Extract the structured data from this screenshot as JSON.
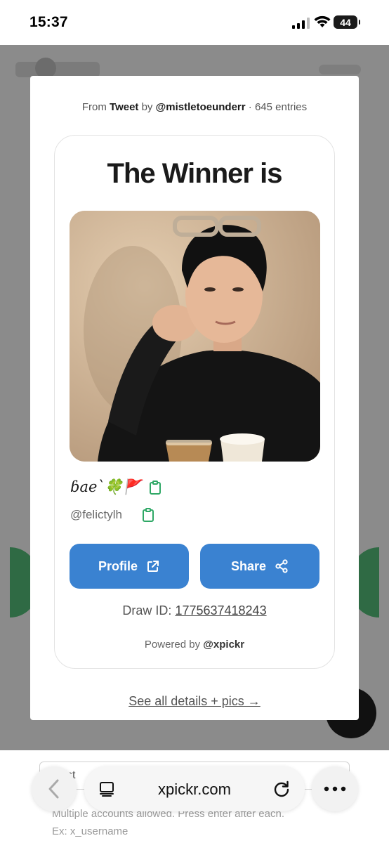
{
  "status_bar": {
    "time": "15:37",
    "battery": "44",
    "icons": [
      "signal-icon",
      "wifi-icon",
      "battery-icon"
    ]
  },
  "modal": {
    "source": {
      "prefix": "From",
      "platform": "Tweet",
      "by": "by",
      "author": "@mistletoeunderr",
      "separator": "·",
      "entries": "645 entries"
    },
    "title": "The Winner is",
    "winner": {
      "display_name": "ɓae`🍀🚩",
      "username": "@felictylh"
    },
    "buttons": {
      "profile_label": "Profile",
      "share_label": "Share"
    },
    "draw_id_label": "Draw ID:",
    "draw_id_value": "1775637418243",
    "powered_prefix": "Powered by",
    "powered_brand": "@xpickr",
    "see_all": "See all details + pics →"
  },
  "background_page": {
    "input_fragment": "st",
    "help_line1": "Multiple accounts allowed. Press enter after each.",
    "help_line2": "Ex: x_username"
  },
  "browser": {
    "url": "xpickr.com"
  },
  "colors": {
    "accent": "#3a82d1",
    "copy_icon": "#2fa866",
    "overlay": "#8b8b8b"
  }
}
